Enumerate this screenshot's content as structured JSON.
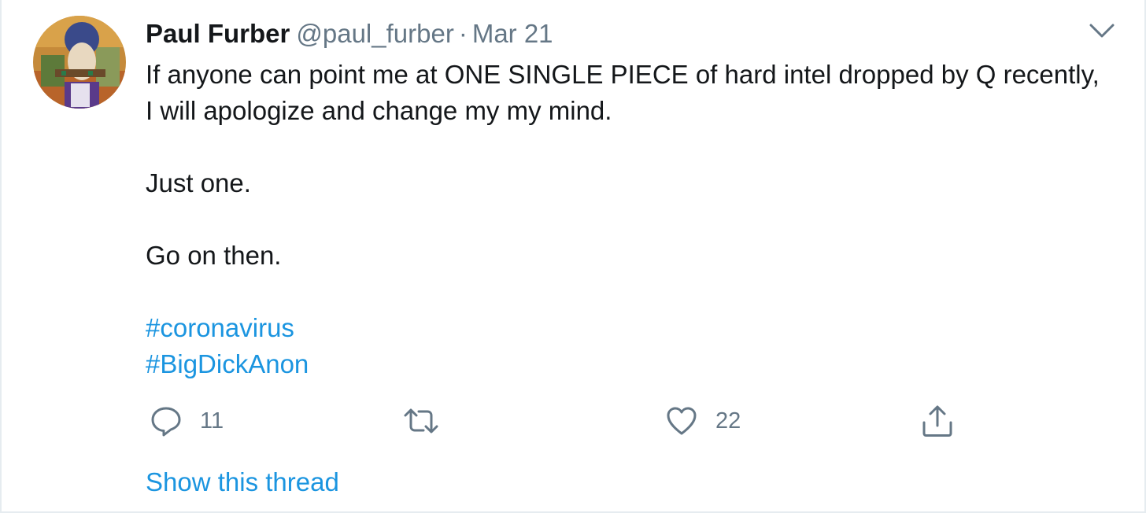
{
  "tweet": {
    "author_name": "Paul Furber",
    "author_handle": "@paul_furber",
    "separator": "·",
    "date": "Mar 21",
    "text_line1": "If anyone can point me at ONE SINGLE PIECE of hard intel dropped by Q recently, I will apologize and change my my mind.",
    "text_line2": "Just one.",
    "text_line3": "Go on then.",
    "hashtags": [
      "#coronavirus",
      "#BigDickAnon"
    ],
    "reply_count": "11",
    "retweet_count": "",
    "like_count": "22",
    "show_thread_label": "Show this thread"
  },
  "colors": {
    "link": "#1b95e0",
    "text": "#14171a",
    "secondary": "#657786",
    "border": "#e6ecf0"
  },
  "icons": {
    "reply": "reply-icon",
    "retweet": "retweet-icon",
    "like": "heart-icon",
    "share": "share-icon",
    "caret": "chevron-down-icon"
  }
}
